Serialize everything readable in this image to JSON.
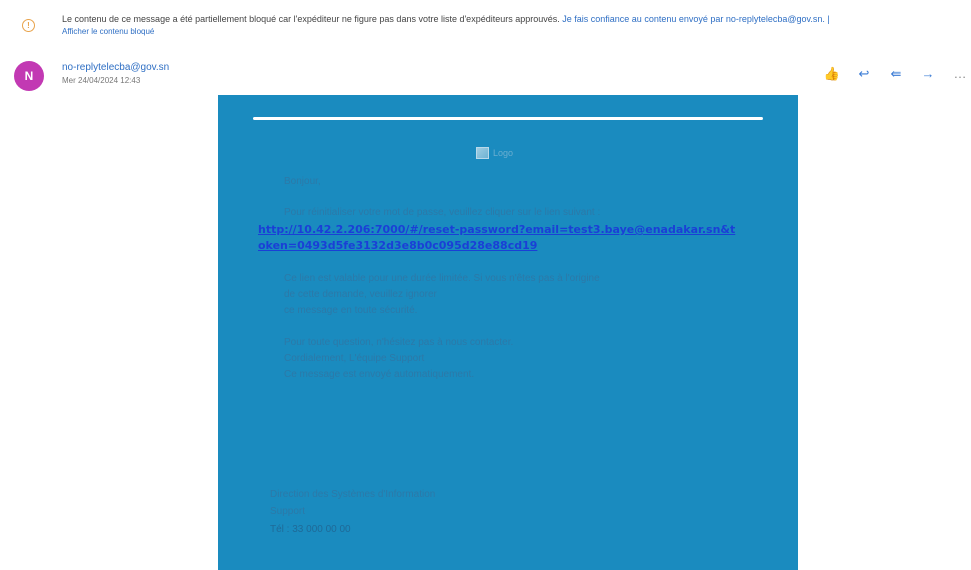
{
  "warning": {
    "icon": "info-circle-icon",
    "text": "Le contenu de ce message a été partiellement bloqué car l'expéditeur ne figure pas dans votre liste d'expéditeurs approuvés.",
    "link_text": "Je fais confiance au contenu envoyé par no-replytelecba@gov.sn. |",
    "sub_link": "Afficher le contenu bloqué"
  },
  "message": {
    "avatar_initial": "N",
    "sender": "no-replytelecba@gov.sn",
    "date": "Mer 24/04/2024 12:43"
  },
  "actions": [
    {
      "name": "like-button",
      "icon": "thumbs-up-icon",
      "glyph": "👍"
    },
    {
      "name": "reply-button",
      "icon": "reply-icon",
      "glyph": "↩"
    },
    {
      "name": "reply-all-button",
      "icon": "reply-all-icon",
      "glyph": "⇚"
    },
    {
      "name": "forward-button",
      "icon": "forward-icon",
      "glyph": "→"
    },
    {
      "name": "more-button",
      "icon": "more-icon",
      "glyph": "…"
    }
  ],
  "body": {
    "logo_alt": "Logo",
    "greeting": "Bonjour,",
    "intro": "Pour réinitialiser votre mot de passe, veuillez cliquer sur le lien suivant :",
    "reset_link": "http://10.42.2.206:7000/#/reset-password?email=test3.baye@enadakar.sn&token=0493d5fe3132d3e8b0c095d28e88cd19",
    "info_lines": [
      "Ce lien est valable pour une durée limitée. Si vous n'êtes pas à l'origine",
      "de cette demande, veuillez ignorer",
      "ce message en toute sécurité."
    ],
    "contact_lines": [
      "Pour toute question, n'hésitez pas à nous contacter.",
      "Cordialement, L'équipe Support",
      "Ce message est envoyé automatiquement."
    ],
    "signature": [
      "Direction des Systèmes d'Information",
      "Support",
      "Tél : 33 000 00 00"
    ]
  }
}
